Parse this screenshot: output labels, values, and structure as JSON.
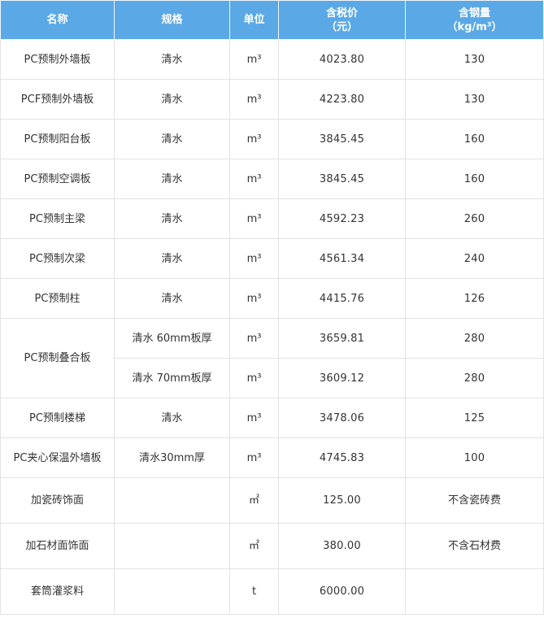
{
  "header": {
    "name": "名称",
    "spec": "规格",
    "unit": "单位",
    "price_line1": "含税价",
    "price_line2": "（元）",
    "steel_line1": "含钢量",
    "steel_line2": "（kg/m³）"
  },
  "rows": [
    {
      "name": "PC预制外墙板",
      "spec": "清水",
      "unit": "m³",
      "price": "4023.80",
      "steel": "130"
    },
    {
      "name": "PCF预制外墙板",
      "spec": "清水",
      "unit": "m³",
      "price": "4223.80",
      "steel": "130"
    },
    {
      "name": "PC预制阳台板",
      "spec": "清水",
      "unit": "m³",
      "price": "3845.45",
      "steel": "160"
    },
    {
      "name": "PC预制空调板",
      "spec": "清水",
      "unit": "m³",
      "price": "3845.45",
      "steel": "160"
    },
    {
      "name": "PC预制主梁",
      "spec": "清水",
      "unit": "m³",
      "price": "4592.23",
      "steel": "260"
    },
    {
      "name": "PC预制次梁",
      "spec": "清水",
      "unit": "m³",
      "price": "4561.34",
      "steel": "240"
    },
    {
      "name": "PC预制柱",
      "spec": "清水",
      "unit": "m³",
      "price": "4415.76",
      "steel": "126"
    },
    {
      "name": "PC预制叠合板",
      "spec": "清水 60mm板厚",
      "unit": "m³",
      "price": "3659.81",
      "steel": "280"
    },
    {
      "name": "",
      "spec": "清水 70mm板厚",
      "unit": "m³",
      "price": "3609.12",
      "steel": "280"
    },
    {
      "name": "PC预制楼梯",
      "spec": "清水",
      "unit": "m³",
      "price": "3478.06",
      "steel": "125"
    },
    {
      "name": "PC夹心保温外墙板",
      "spec": "清水30mm厚",
      "unit": "m³",
      "price": "4745.83",
      "steel": "100"
    },
    {
      "name": "加瓷砖饰面",
      "spec": "",
      "unit": "㎡",
      "price": "125.00",
      "steel": "不含瓷砖费"
    },
    {
      "name": "加石材面饰面",
      "spec": "",
      "unit": "㎡",
      "price": "380.00",
      "steel": "不含石材费"
    },
    {
      "name": "套筒灌浆料",
      "spec": "",
      "unit": "t",
      "price": "6000.00",
      "steel": ""
    }
  ]
}
